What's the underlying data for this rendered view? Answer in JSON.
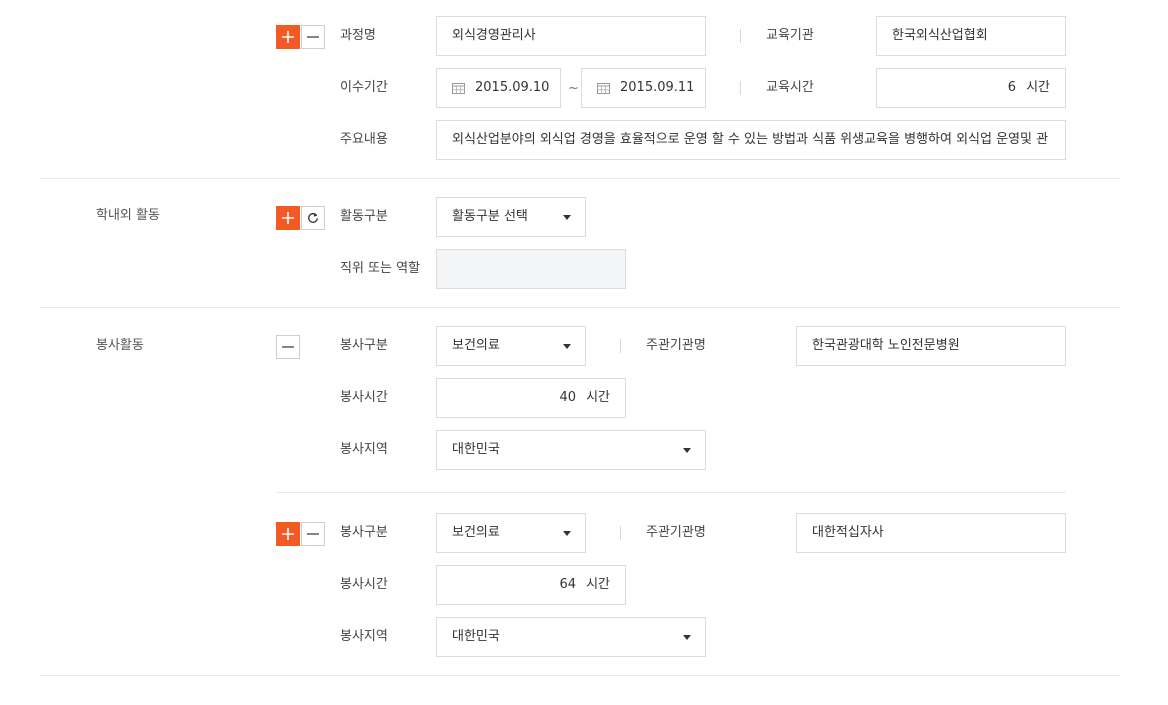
{
  "education": {
    "course_label": "과정명",
    "course_value": "외식경영관리사",
    "institution_label": "교육기관",
    "institution_value": "한국외식산업협회",
    "period_label": "이수기간",
    "period_start": "2015.09.10",
    "period_tilde": "~",
    "period_end": "2015.09.11",
    "hours_label": "교육시간",
    "hours_value": "6",
    "hours_unit": "시간",
    "content_label": "주요내용",
    "content_value": "외식산업분야의 외식업 경영을 효율적으로 운영 할 수 있는 방법과 식품 위생교육을 병행하여 외식업 운영및 관"
  },
  "activity": {
    "section_title": "학내외 활동",
    "type_label": "활동구분",
    "type_value": "활동구분 선택",
    "role_label": "직위 또는 역할",
    "role_value": ""
  },
  "volunteer": {
    "section_title": "봉사활동",
    "entries": [
      {
        "type_label": "봉사구분",
        "type_value": "보건의료",
        "org_label": "주관기관명",
        "org_value": "한국관광대학 노인전문병원",
        "hours_label": "봉사시간",
        "hours_value": "40",
        "hours_unit": "시간",
        "region_label": "봉사지역",
        "region_value": "대한민국"
      },
      {
        "type_label": "봉사구분",
        "type_value": "보건의료",
        "org_label": "주관기관명",
        "org_value": "대한적십자사",
        "hours_label": "봉사시간",
        "hours_value": "64",
        "hours_unit": "시간",
        "region_label": "봉사지역",
        "region_value": "대한민국"
      }
    ]
  },
  "colors": {
    "accent": "#f15a22",
    "border": "#dcdcdc",
    "disabled_bg": "#f4f5f7",
    "divider": "#e8e8e8"
  }
}
